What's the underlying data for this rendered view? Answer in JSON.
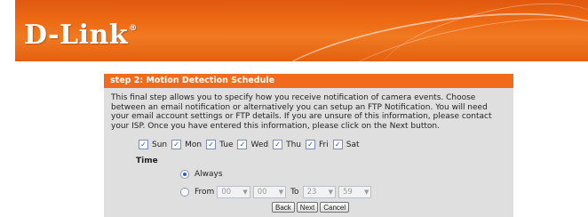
{
  "header": {
    "brand": "D-Link",
    "brand_mark": "®",
    "colors": {
      "banner": "#ee6a14"
    }
  },
  "panel": {
    "title": "step 2: Motion Detection Schedule",
    "description": "This final step allows you to specify how you receive notification of camera events. Choose between an email notification or alternatively you can setup an FTP Notification. You will need your email account settings or FTP details. If you are unsure of this information, please contact your ISP. Once you have entered this information, please click on the Next button.",
    "days": [
      {
        "label": "Sun",
        "checked": true
      },
      {
        "label": "Mon",
        "checked": true
      },
      {
        "label": "Tue",
        "checked": true
      },
      {
        "label": "Wed",
        "checked": true
      },
      {
        "label": "Thu",
        "checked": true
      },
      {
        "label": "Fri",
        "checked": true
      },
      {
        "label": "Sat",
        "checked": true
      }
    ],
    "time_label": "Time",
    "always_label": "Always",
    "from_label": "From",
    "to_label": "To",
    "from_hour": "00",
    "from_min": "00",
    "to_hour": "23",
    "to_min": "59",
    "selected_option": "Always"
  },
  "buttons": {
    "back": "Back",
    "next": "Next",
    "cancel": "Cancel"
  }
}
